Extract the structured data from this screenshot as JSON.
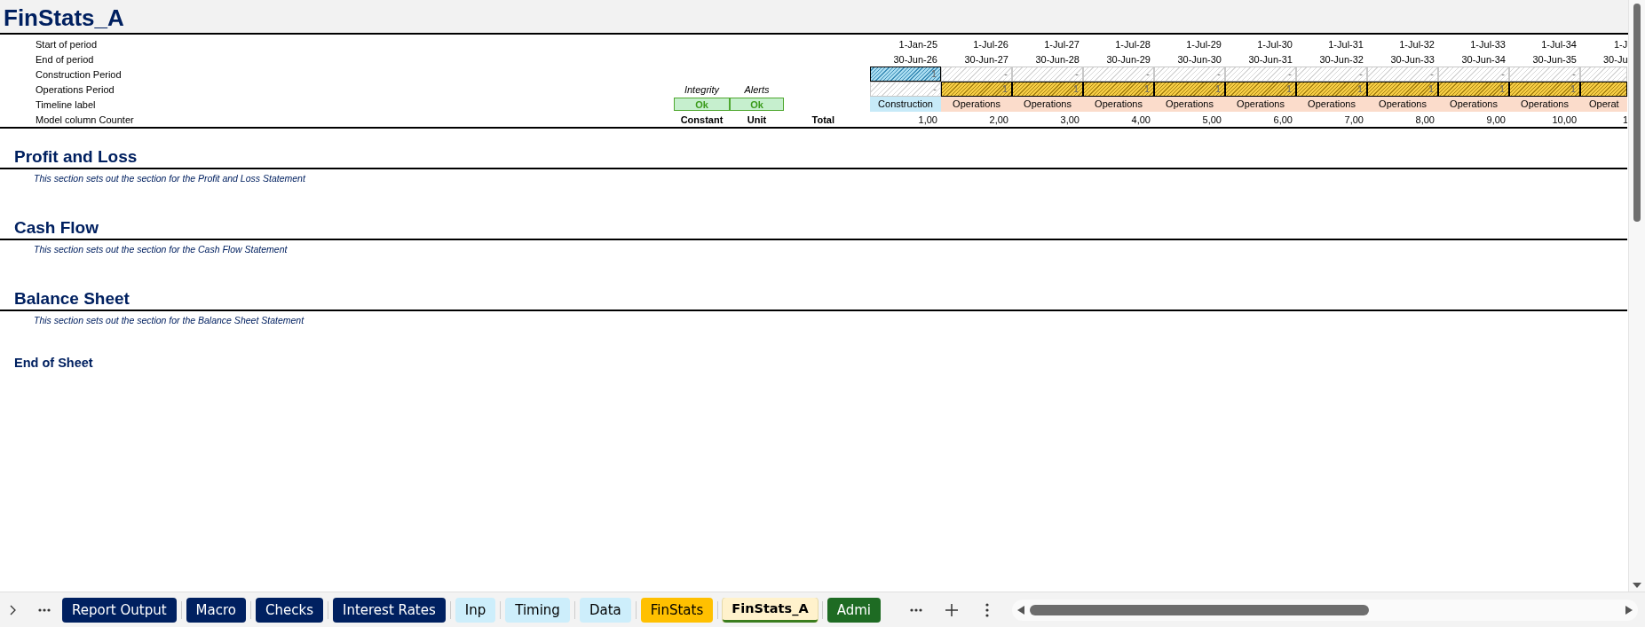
{
  "sheet": {
    "title": "FinStats_A"
  },
  "row_labels": [
    "Start of period",
    "End of period",
    "Construction Period",
    "Operations Period",
    "Timeline label",
    "Model column Counter"
  ],
  "checks": {
    "headers": [
      "Integrity",
      "Alerts"
    ],
    "values": [
      "Ok",
      "Ok"
    ],
    "columns": [
      "Constant",
      "Unit",
      "Total"
    ]
  },
  "timeline": [
    {
      "start": "1-Jan-25",
      "end": "30-Jun-26",
      "construction": {
        "value": "1",
        "on": true
      },
      "operations": {
        "value": "-",
        "on": false
      },
      "label": "Construction",
      "kind": "construction",
      "counter": "1,00"
    },
    {
      "start": "1-Jul-26",
      "end": "30-Jun-27",
      "construction": {
        "value": "-",
        "on": false
      },
      "operations": {
        "value": "1",
        "on": true
      },
      "label": "Operations",
      "kind": "operations",
      "counter": "2,00"
    },
    {
      "start": "1-Jul-27",
      "end": "30-Jun-28",
      "construction": {
        "value": "-",
        "on": false
      },
      "operations": {
        "value": "1",
        "on": true
      },
      "label": "Operations",
      "kind": "operations",
      "counter": "3,00"
    },
    {
      "start": "1-Jul-28",
      "end": "30-Jun-29",
      "construction": {
        "value": "-",
        "on": false
      },
      "operations": {
        "value": "1",
        "on": true
      },
      "label": "Operations",
      "kind": "operations",
      "counter": "4,00"
    },
    {
      "start": "1-Jul-29",
      "end": "30-Jun-30",
      "construction": {
        "value": "-",
        "on": false
      },
      "operations": {
        "value": "1",
        "on": true
      },
      "label": "Operations",
      "kind": "operations",
      "counter": "5,00"
    },
    {
      "start": "1-Jul-30",
      "end": "30-Jun-31",
      "construction": {
        "value": "-",
        "on": false
      },
      "operations": {
        "value": "1",
        "on": true
      },
      "label": "Operations",
      "kind": "operations",
      "counter": "6,00"
    },
    {
      "start": "1-Jul-31",
      "end": "30-Jun-32",
      "construction": {
        "value": "-",
        "on": false
      },
      "operations": {
        "value": "1",
        "on": true
      },
      "label": "Operations",
      "kind": "operations",
      "counter": "7,00"
    },
    {
      "start": "1-Jul-32",
      "end": "30-Jun-33",
      "construction": {
        "value": "-",
        "on": false
      },
      "operations": {
        "value": "1",
        "on": true
      },
      "label": "Operations",
      "kind": "operations",
      "counter": "8,00"
    },
    {
      "start": "1-Jul-33",
      "end": "30-Jun-34",
      "construction": {
        "value": "-",
        "on": false
      },
      "operations": {
        "value": "1",
        "on": true
      },
      "label": "Operations",
      "kind": "operations",
      "counter": "9,00"
    },
    {
      "start": "1-Jul-34",
      "end": "30-Jun-35",
      "construction": {
        "value": "-",
        "on": false
      },
      "operations": {
        "value": "1",
        "on": true
      },
      "label": "Operations",
      "kind": "operations",
      "counter": "10,00"
    },
    {
      "start": "1-J",
      "end": "30-Ju",
      "construction": {
        "on": false
      },
      "operations": {
        "on": true
      },
      "label": "Operat",
      "kind": "operations",
      "counter": "1"
    }
  ],
  "sections": [
    {
      "title": "Profit and Loss",
      "description": "This section sets out the section for the Profit and Loss Statement"
    },
    {
      "title": "Cash Flow",
      "description": "This section sets out the section for the Cash Flow Statement"
    },
    {
      "title": "Balance Sheet",
      "description": "This section sets out the section for the Balance Sheet Statement"
    }
  ],
  "end_label": "End of Sheet",
  "tabs": [
    {
      "label": "Report Output",
      "color": "#002060",
      "selected": false
    },
    {
      "label": "Macro",
      "color": "#002060",
      "selected": false
    },
    {
      "label": "Checks",
      "color": "#002060",
      "selected": false
    },
    {
      "label": "Interest Rates",
      "color": "#002060",
      "selected": false
    },
    {
      "label": "Inp",
      "color": "#cdeefb",
      "selected": false
    },
    {
      "label": "Timing",
      "color": "#cdeefb",
      "selected": false
    },
    {
      "label": "Data",
      "color": "#cdeefb",
      "selected": false
    },
    {
      "label": "FinStats",
      "color": "#ffc000",
      "selected": false
    },
    {
      "label": "FinStats_A",
      "color": "#fff2cc",
      "selected": true
    },
    {
      "label": "Admi",
      "color": "#1e6b23",
      "selected": false
    }
  ]
}
